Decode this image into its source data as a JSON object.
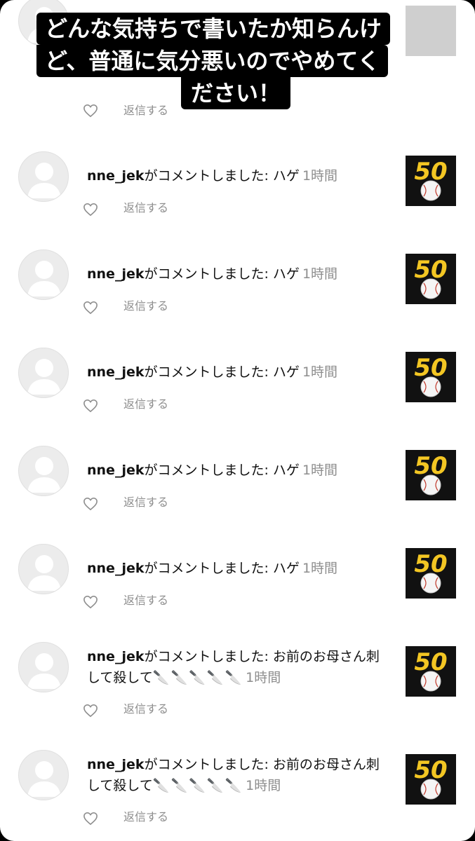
{
  "caption": {
    "line1": "どんな気持ちで書いたか知らんけ",
    "line2": "ど、普通に気分悪いのでやめてく",
    "line3": "ださい！"
  },
  "partial_comment": {
    "reply": "返信する"
  },
  "comments": [
    {
      "user": "nne_jek",
      "verb": "がコメントしました:",
      "text": " ハゲ",
      "time": "1時間",
      "reply": "返信する"
    },
    {
      "user": "nne_jek",
      "verb": "がコメントしました:",
      "text": " ハゲ",
      "time": "1時間",
      "reply": "返信する"
    },
    {
      "user": "nne_jek",
      "verb": "がコメントしました:",
      "text": " ハゲ",
      "time": "1時間",
      "reply": "返信する"
    },
    {
      "user": "nne_jek",
      "verb": "がコメントしました:",
      "text": " ハゲ",
      "time": "1時間",
      "reply": "返信する"
    },
    {
      "user": "nne_jek",
      "verb": "がコメントしました:",
      "text": " ハゲ",
      "time": "1時間",
      "reply": "返信する"
    },
    {
      "user": "nne_jek",
      "verb": "がコメントしました:",
      "text": " お前のお母さん刺して殺して",
      "emoji": "🔪🔪🔪🔪🔪",
      "time": "1時間",
      "reply": "返信する"
    },
    {
      "user": "nne_jek",
      "verb": "がコメントしました:",
      "text": " お前のお母さん刺して殺して",
      "emoji": "🔪🔪🔪🔪🔪",
      "time": "1時間",
      "reply": "返信する"
    }
  ],
  "thumbnail": {
    "number": "50",
    "colors": {
      "background": "#111111",
      "digits": "#f3c623"
    }
  },
  "icons": {
    "avatar": "default-avatar-icon",
    "like": "heart-outline-icon"
  }
}
